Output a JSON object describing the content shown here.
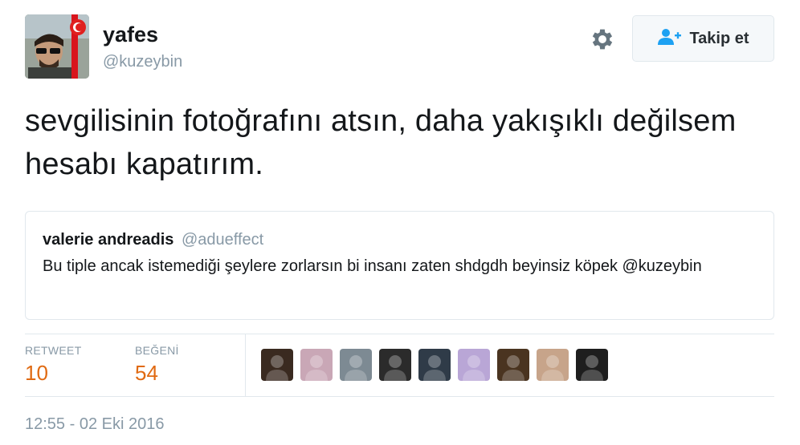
{
  "author": {
    "name": "yafes",
    "handle": "@kuzeybin",
    "avatar_icon": "user-avatar-photo"
  },
  "actions": {
    "settings_icon": "gear-icon",
    "follow_icon": "add-user-icon",
    "follow_label": "Takip et"
  },
  "tweet": {
    "text": "sevgilisinin fotoğrafını atsın, daha yakışıklı değilsem hesabı kapatırım."
  },
  "quote": {
    "name": "valerie andreadis",
    "handle": "@adueffect",
    "text": "Bu tiple ancak istemediği şeylere zorlarsın bi insanı zaten shdgdh beyinsiz köpek @kuzeybin"
  },
  "stats": {
    "retweet_label": "RETWEET",
    "retweet_count": "10",
    "like_label": "BEĞENİ",
    "like_count": "54"
  },
  "likers": [
    {
      "icon": "liker-avatar-1",
      "color": "#3a2a20"
    },
    {
      "icon": "liker-avatar-2",
      "color": "#c9a7b6"
    },
    {
      "icon": "liker-avatar-3",
      "color": "#7d8a93"
    },
    {
      "icon": "liker-avatar-4",
      "color": "#2b2b2b"
    },
    {
      "icon": "liker-avatar-5",
      "color": "#2f3b48"
    },
    {
      "icon": "liker-avatar-6",
      "color": "#b9a6d6"
    },
    {
      "icon": "liker-avatar-7",
      "color": "#4a3420"
    },
    {
      "icon": "liker-avatar-8",
      "color": "#c7a48a"
    },
    {
      "icon": "liker-avatar-9",
      "color": "#1e1e1e"
    }
  ],
  "timestamp": "12:55 - 02 Eki 2016",
  "colors": {
    "accent_count": "#e06a12",
    "follow_icon": "#1da1f2",
    "muted": "#8899a6"
  }
}
